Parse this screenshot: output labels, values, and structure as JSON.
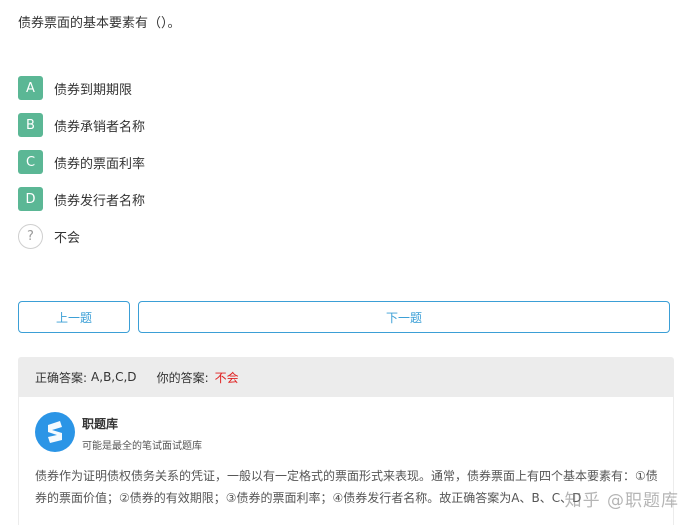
{
  "question": "债券票面的基本要素有（）。",
  "options": [
    {
      "letter": "A",
      "text": "债券到期期限"
    },
    {
      "letter": "B",
      "text": "债券承销者名称"
    },
    {
      "letter": "C",
      "text": "债券的票面利率"
    },
    {
      "letter": "D",
      "text": "债券发行者名称"
    }
  ],
  "unknown_option": {
    "icon": "?",
    "text": "不会"
  },
  "buttons": {
    "prev": "上一题",
    "next": "下一题"
  },
  "answer": {
    "correct_label": "正确答案:",
    "correct_value": "A,B,C,D",
    "your_label": "你的答案:",
    "your_value": "不会"
  },
  "source": {
    "name": "职题库",
    "slogan": "可能是最全的笔试面试题库"
  },
  "explanation": "债券作为证明债权债务关系的凭证，一般以有一定格式的票面形式来表现。通常，债券票面上有四个基本要素有：①债券的票面价值；②债券的有效期限；③债券的票面利率；④债券发行者名称。故正确答案为A、B、C、D",
  "watermark": "知乎 @职题库",
  "colors": {
    "accent": "#5bb795",
    "button": "#3b9fd6",
    "wrong": "#e02020",
    "logo": "#2b95e6"
  }
}
